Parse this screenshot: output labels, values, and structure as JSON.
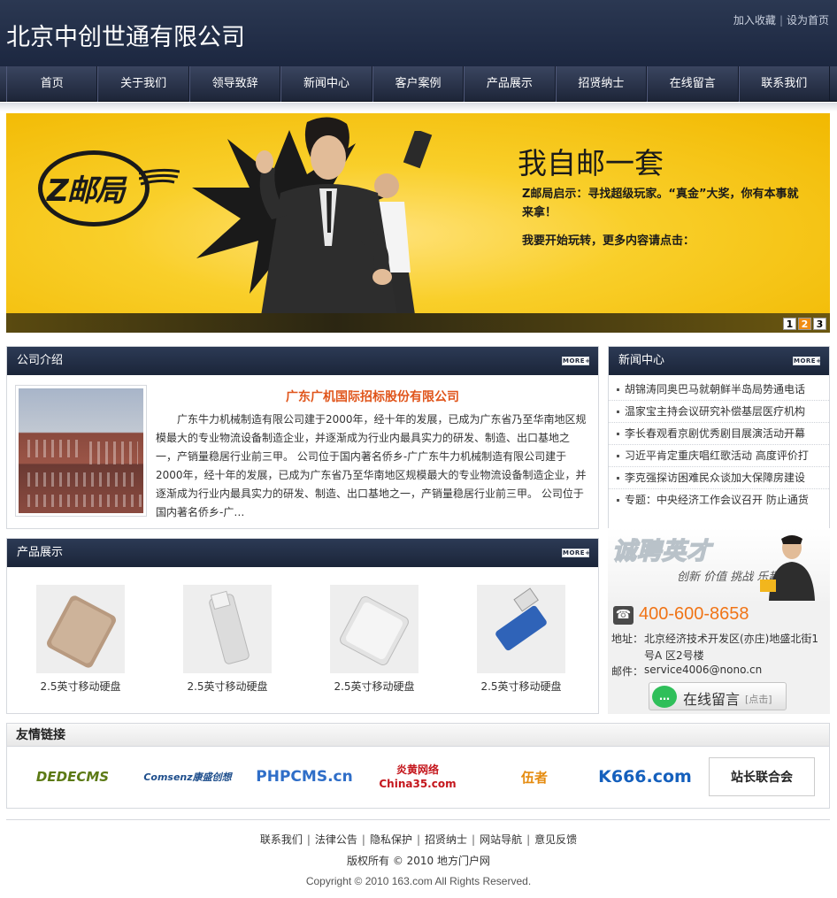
{
  "header": {
    "site_title": "北京中创世通有限公司",
    "add_favorite": "加入收藏",
    "set_homepage": "设为首页"
  },
  "nav": {
    "items": [
      "首页",
      "关于我们",
      "领导致辞",
      "新闻中心",
      "客户案例",
      "产品展示",
      "招贤纳士",
      "在线留言",
      "联系我们"
    ]
  },
  "banner": {
    "logo_text": "Z邮局",
    "headline": "我自邮一套",
    "line1": "Z邮局启示：寻找超级玩家。“真金”大奖，你有本事就来拿！",
    "line2": "我要开始玩转，更多内容请点击：",
    "pages": [
      "1",
      "2",
      "3"
    ],
    "active_page": 2
  },
  "intro": {
    "title": "公司介绍",
    "more": "MORE+",
    "heading": "广东广机国际招标股份有限公司",
    "text": "广东牛力机械制造有限公司建于2000年，经十年的发展，已成为广东省乃至华南地区规模最大的专业物流设备制造企业，并逐渐成为行业内最具实力的研发、制造、出口基地之一，产销量稳居行业前三甲。 公司位于国内著名侨乡-广广东牛力机械制造有限公司建于2000年，经十年的发展，已成为广东省乃至华南地区规模最大的专业物流设备制造企业，并逐渐成为行业内最具实力的研发、制造、出口基地之一，产销量稳居行业前三甲。 公司位于国内著名侨乡-广…"
  },
  "news": {
    "title": "新闻中心",
    "more": "MORE+",
    "items": [
      "胡锦涛同奥巴马就朝鲜半岛局势通电话",
      "温家宝主持会议研究补偿基层医疗机构",
      "李长春观看京剧优秀剧目展演活动开幕",
      "习近平肯定重庆唱红歌活动 高度评价打",
      "李克强探访困难民众谈加大保障房建设",
      "专题：中央经济工作会议召开 防止通货"
    ]
  },
  "products": {
    "title": "产品展示",
    "more": "MORE+",
    "items": [
      "2.5英寸移动硬盘",
      "2.5英寸移动硬盘",
      "2.5英寸移动硬盘",
      "2.5英寸移动硬盘"
    ]
  },
  "recruit": {
    "title": "诚聘英才",
    "sub": "创新 价值 挑战 乐趣"
  },
  "contact": {
    "phone": "400-600-8658",
    "address_label": "地址：",
    "address": "北京经济技术开发区(亦庄)地盛北街1号A 区2号楼",
    "email_label": "邮件：",
    "email": "service4006@nono.cn",
    "message_button": "在线留言",
    "message_hint": "[点击]"
  },
  "links": {
    "title": "友情链接",
    "items": [
      "DEDECMS",
      "Comsenz康盛创想",
      "PHPCMS.cn",
      "炎黄网络 China35.com",
      "伍者",
      "K666.com",
      "站长联合会"
    ]
  },
  "footer": {
    "links": [
      "联系我们",
      "法律公告",
      "隐私保护",
      "招贤纳士",
      "网站导航",
      "意见反馈"
    ],
    "rights": "版权所有 © 2010 地方门户网",
    "copyright": "Copyright © 2010 163.com All Rights Reserved."
  },
  "colors": {
    "header_dark": "#1c2740",
    "banner_yellow": "#f6c520",
    "accent_orange": "#e0551b",
    "phone_orange": "#f07416"
  }
}
